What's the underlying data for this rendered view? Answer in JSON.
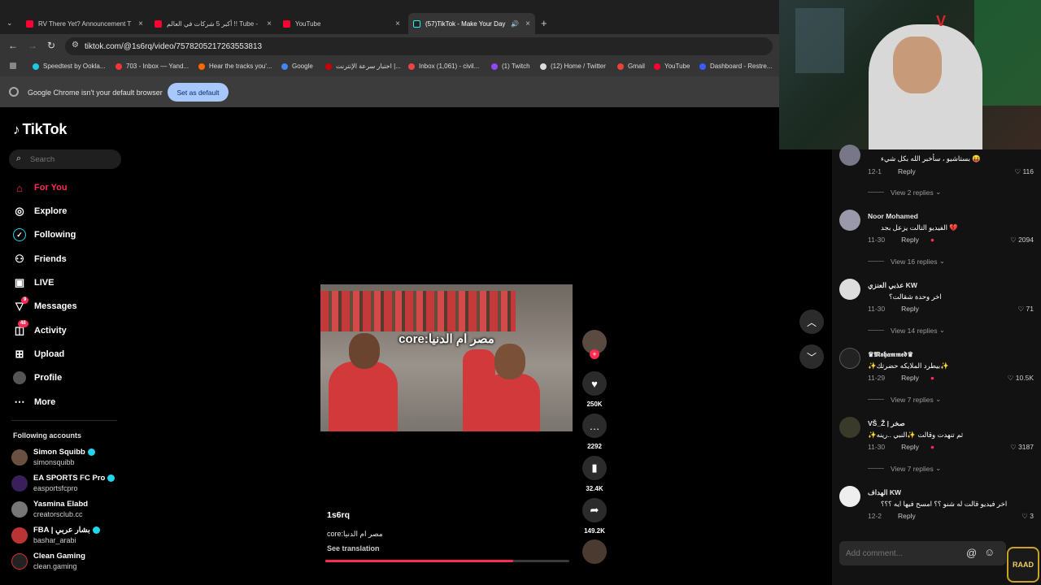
{
  "browser": {
    "tabs": [
      {
        "title": "RV There Yet? Announcement T",
        "icon": "youtube-icon"
      },
      {
        "title": "أكبر 5 شركات في العالم !! Tube -",
        "icon": "youtube-icon"
      },
      {
        "title": "YouTube",
        "icon": "youtube-icon"
      },
      {
        "title": "(57)TikTok - Make Your Day",
        "icon": "tiktok-icon"
      }
    ],
    "url": "tiktok.com/@1s6rq/video/7578205217263553813",
    "bookmarks": [
      "Speedtest by Ookla...",
      "703 - Inbox — Yand...",
      "Hear the tracks you'...",
      "Google",
      "اختبار سرعة الإنترنت |...",
      "Inbox (1,061) - civil...",
      "(1) Twitch",
      "(12) Home / Twitter",
      "Gmail",
      "YouTube",
      "Dashboard - Restre..."
    ],
    "infobar": {
      "message": "Google Chrome isn't your default browser",
      "button": "Set as default"
    }
  },
  "sidebar": {
    "logo": "TikTok",
    "search_placeholder": "Search",
    "nav": [
      {
        "label": "For You",
        "icon": "home-icon",
        "active": true
      },
      {
        "label": "Explore",
        "icon": "compass-icon"
      },
      {
        "label": "Following",
        "icon": "following-icon"
      },
      {
        "label": "Friends",
        "icon": "friends-icon"
      },
      {
        "label": "LIVE",
        "icon": "live-icon"
      },
      {
        "label": "Messages",
        "icon": "messages-icon",
        "badge": "9"
      },
      {
        "label": "Activity",
        "icon": "activity-icon",
        "badge": "48"
      },
      {
        "label": "Upload",
        "icon": "upload-icon"
      },
      {
        "label": "Profile",
        "icon": "profile-icon"
      },
      {
        "label": "More",
        "icon": "more-icon"
      }
    ],
    "following_title": "Following accounts",
    "accounts": [
      {
        "name": "Simon Squibb",
        "handle": "simonsquibb",
        "verified": true
      },
      {
        "name": "EA SPORTS FC Pro",
        "handle": "easportsfcpro",
        "verified": true
      },
      {
        "name": "Yasmina Elabd",
        "handle": "creatorsclub.cc",
        "verified": false
      },
      {
        "name": "FBA | بشار عربي",
        "handle": "bashar_arabi",
        "verified": true
      },
      {
        "name": "Clean Gaming",
        "handle": "clean.gaming",
        "verified": false
      }
    ]
  },
  "video": {
    "overlay_text": "core:مصر ام الدنيا",
    "author": "1s6rq",
    "caption": "core:مصر ام الدنيا",
    "see_translation": "See translation",
    "progress": 0.77,
    "likes": "250K",
    "comments": "2292",
    "saves": "32.4K",
    "shares": "149.2K"
  },
  "comments": {
    "items": [
      {
        "user": "",
        "text": "بستاشيو ، سأخبر الله بكل شيء 😝",
        "date": "12-1",
        "reply": "Reply",
        "likes": "116",
        "view_replies": "View 2 replies",
        "liked_by_creator": false
      },
      {
        "user": "Noor Mohamed",
        "text": "الفيديو التالت يزعل بجد 💔",
        "date": "11-30",
        "reply": "Reply",
        "likes": "2094",
        "view_replies": "View 16 replies",
        "liked_by_creator": true
      },
      {
        "user": "عذبي العنزي KW",
        "text": "اخر وحدة شقالت؟",
        "date": "11-30",
        "reply": "Reply",
        "likes": "71",
        "view_replies": "View 14 replies",
        "liked_by_creator": false
      },
      {
        "user": "♛𝕸𝖔𝖍𝖆𝖒𝖒𝖊𝖉♛",
        "text": "✨بيطرد الملايكه حضرتك✨",
        "date": "11-29",
        "reply": "Reply",
        "likes": "10.5K",
        "view_replies": "View 7 replies",
        "liked_by_creator": true
      },
      {
        "user": "VŠ_Ž | صخر",
        "text": "✨ثم تنهدت وقالت ✨النبي ..رينه",
        "date": "11-30",
        "reply": "Reply",
        "likes": "3187",
        "view_replies": "View 7 replies",
        "liked_by_creator": true
      },
      {
        "user": "الهداف KW",
        "text": "اخر فيديو قالت له شنو ؟؟ امسح فيها ايه ؟؟؟",
        "date": "12-2",
        "reply": "Reply",
        "likes": "3",
        "view_replies": "",
        "liked_by_creator": false
      }
    ],
    "add_placeholder": "Add comment..."
  },
  "overlay": {
    "badge": "RAAD"
  },
  "colors": {
    "accent": "#fe2c55",
    "teal": "#20d5ec",
    "bg": "#000000"
  }
}
